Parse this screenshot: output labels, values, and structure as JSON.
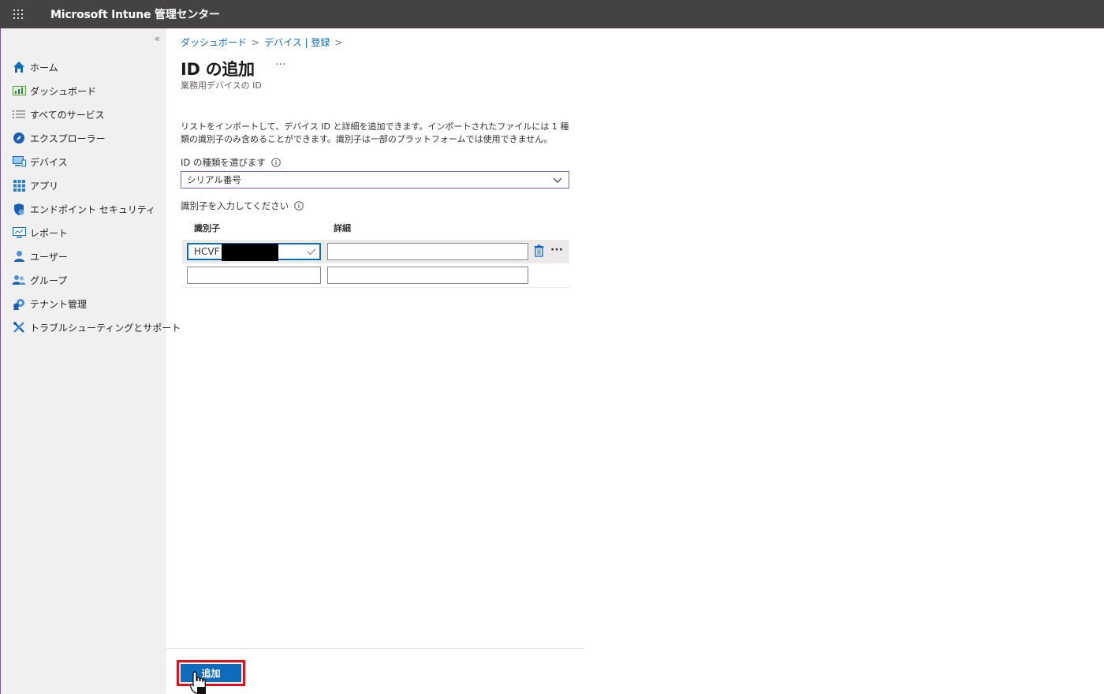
{
  "app": {
    "title": "Microsoft Intune 管理センター"
  },
  "sidebar": {
    "collapse_label": "«",
    "items": [
      {
        "label": "ホーム",
        "icon": "home-icon"
      },
      {
        "label": "ダッシュボード",
        "icon": "dashboard-icon"
      },
      {
        "label": "すべてのサービス",
        "icon": "list-icon"
      },
      {
        "label": "エクスプローラー",
        "icon": "explorer-icon"
      },
      {
        "label": "デバイス",
        "icon": "devices-icon"
      },
      {
        "label": "アプリ",
        "icon": "apps-icon"
      },
      {
        "label": "エンドポイント セキュリティ",
        "icon": "shield-icon"
      },
      {
        "label": "レポート",
        "icon": "reports-icon"
      },
      {
        "label": "ユーザー",
        "icon": "user-icon"
      },
      {
        "label": "グループ",
        "icon": "group-icon"
      },
      {
        "label": "テナント管理",
        "icon": "tenant-icon"
      },
      {
        "label": "トラブルシューティングとサポート",
        "icon": "tools-icon"
      }
    ]
  },
  "breadcrumb": {
    "items": [
      "ダッシュボード",
      "デバイス | 登録"
    ],
    "separator": ">"
  },
  "page": {
    "title": "ID の追加",
    "more": "···",
    "subtitle": "業務用デバイスの ID"
  },
  "form": {
    "description": "リストをインポートして、デバイス ID と詳細を追加できます。インポートされたファイルには 1 種類の識別子のみ含めることができます。識別子は一部のプラットフォームでは使用できません。",
    "id_type_label": "ID の種類を選びます",
    "id_type_value": "シリアル番号",
    "identifier_label": "識別子を入力してください",
    "columns": {
      "identifier": "識別子",
      "details": "詳細"
    },
    "rows": [
      {
        "identifier": "HCVF",
        "details": ""
      },
      {
        "identifier": "",
        "details": ""
      }
    ],
    "row_more": "···"
  },
  "footer": {
    "add_label": "追加"
  },
  "colors": {
    "accent": "#0f6cbd",
    "topbar": "#444242",
    "highlight": "#e0101d"
  }
}
